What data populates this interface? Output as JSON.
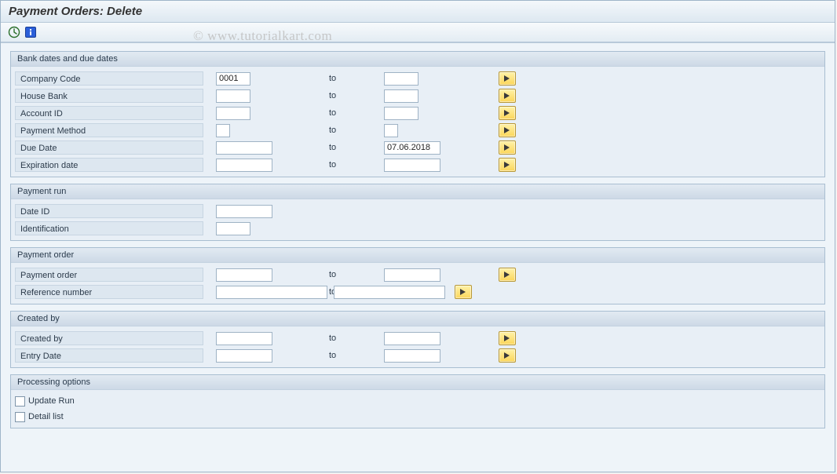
{
  "title": "Payment Orders: Delete",
  "watermark": "© www.tutorialkart.com",
  "toolbar": {
    "execute": "Execute",
    "info": "Information"
  },
  "to_label": "to",
  "groups": {
    "bank_dates": {
      "title": "Bank dates and due dates",
      "company_code": {
        "label": "Company Code",
        "from": "0001",
        "to": ""
      },
      "house_bank": {
        "label": "House Bank",
        "from": "",
        "to": ""
      },
      "account_id": {
        "label": "Account ID",
        "from": "",
        "to": ""
      },
      "payment_method": {
        "label": "Payment Method",
        "from": "",
        "to": ""
      },
      "due_date": {
        "label": "Due Date",
        "from": "",
        "to": "07.06.2018"
      },
      "expiration_date": {
        "label": "Expiration date",
        "from": "",
        "to": ""
      }
    },
    "payment_run": {
      "title": "Payment run",
      "date_id": {
        "label": "Date ID",
        "value": ""
      },
      "identification": {
        "label": "Identification",
        "value": ""
      }
    },
    "payment_order": {
      "title": "Payment order",
      "payment_order": {
        "label": "Payment order",
        "from": "",
        "to": ""
      },
      "reference_number": {
        "label": "Reference number",
        "from": "",
        "to": ""
      }
    },
    "created_by": {
      "title": "Created by",
      "created_by": {
        "label": "Created by",
        "from": "",
        "to": ""
      },
      "entry_date": {
        "label": "Entry Date",
        "from": "",
        "to": ""
      }
    },
    "processing_options": {
      "title": "Processing options",
      "update_run": {
        "label": "Update Run",
        "checked": false
      },
      "detail_list": {
        "label": "Detail list",
        "checked": false
      }
    }
  }
}
